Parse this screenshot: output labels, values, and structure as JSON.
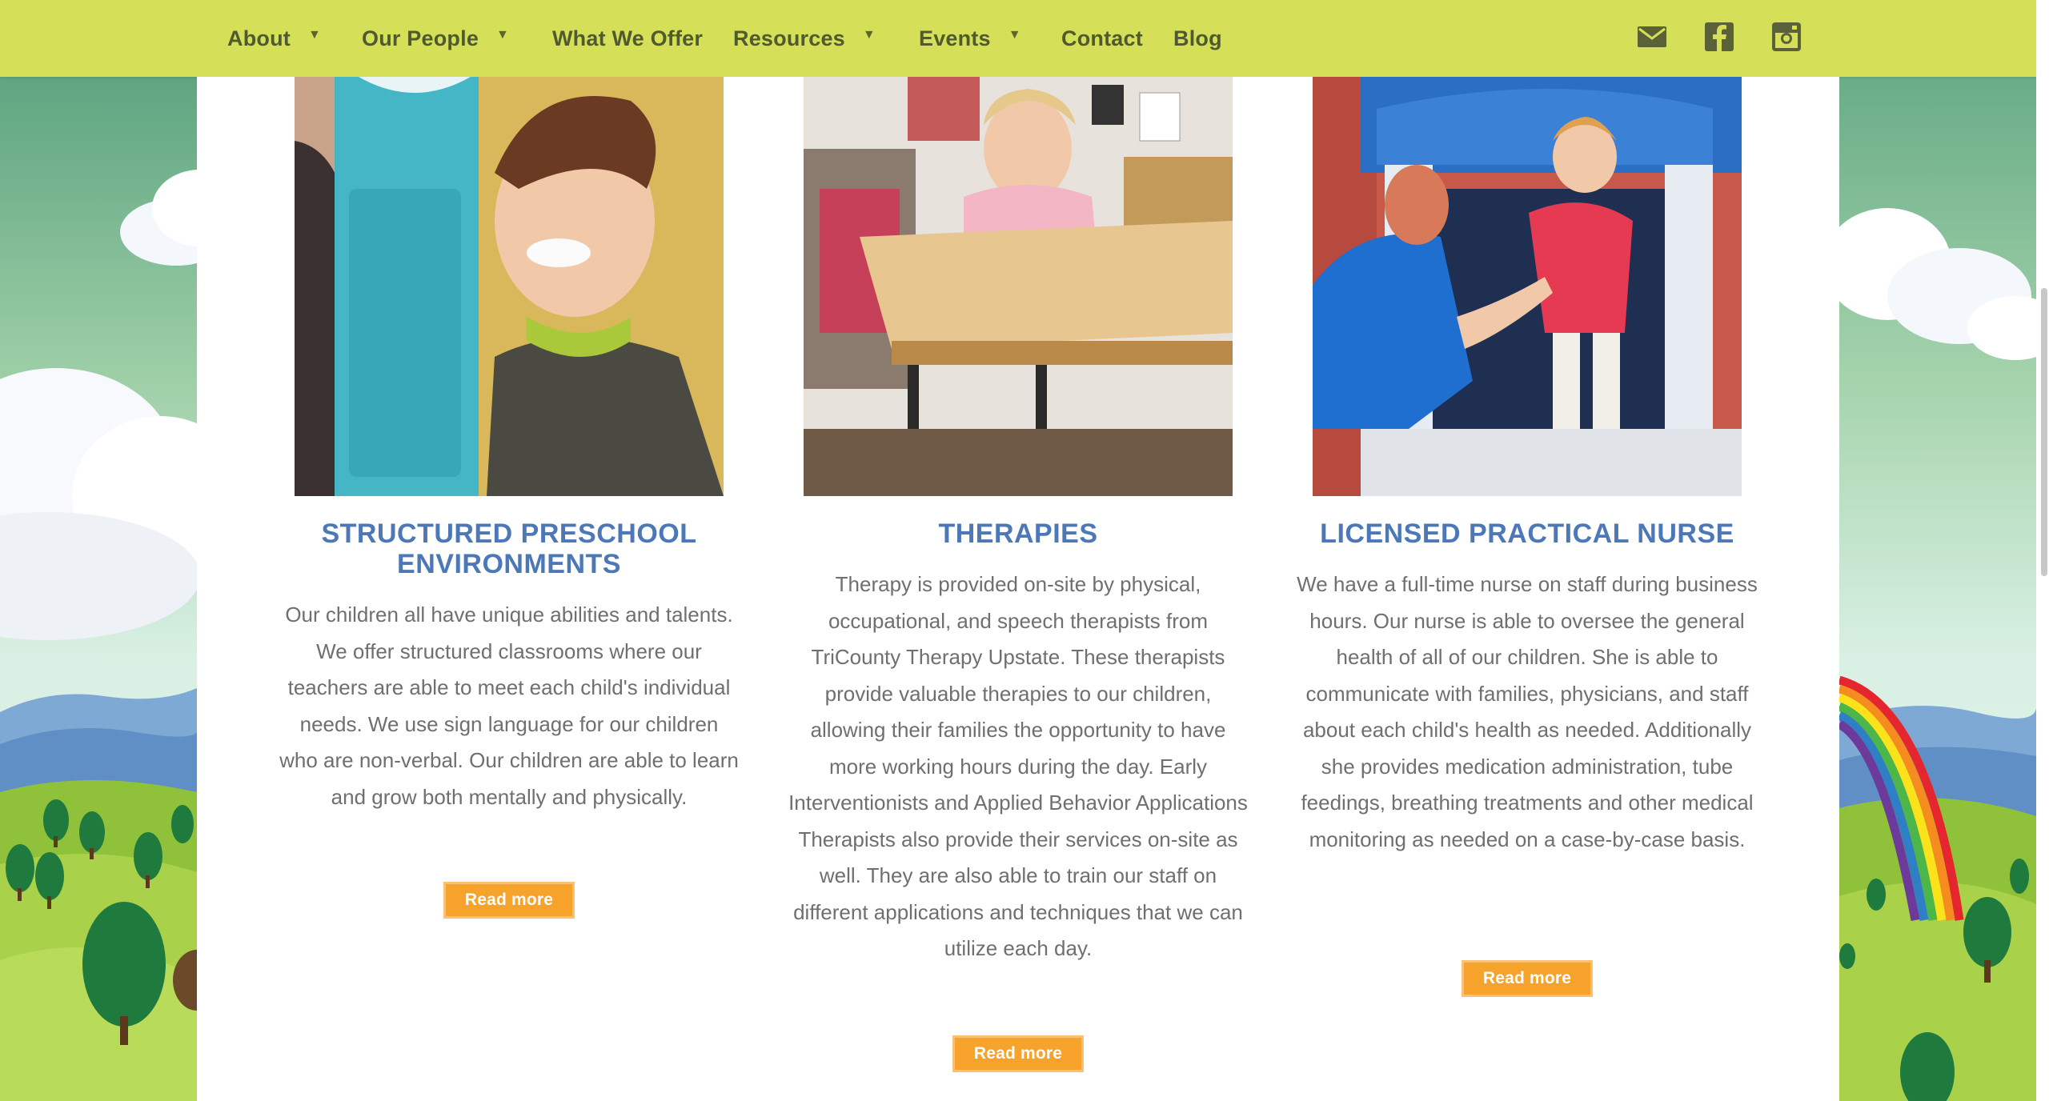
{
  "nav": {
    "items": [
      {
        "label": "About",
        "has_dropdown": true
      },
      {
        "label": "Our People",
        "has_dropdown": true
      },
      {
        "label": "What We Offer",
        "has_dropdown": false
      },
      {
        "label": "Resources",
        "has_dropdown": true
      },
      {
        "label": "Events",
        "has_dropdown": true
      },
      {
        "label": "Contact",
        "has_dropdown": false
      },
      {
        "label": "Blog",
        "has_dropdown": false
      }
    ],
    "caret_glyph": "▼",
    "social_icons": [
      "email-icon",
      "facebook-icon",
      "instagram-icon"
    ],
    "background_color": "#d5df57"
  },
  "cards": [
    {
      "title": "STRUCTURED PRESCHOOL ENVIRONMENTS",
      "body": "Our children all have unique abilities and talents. We offer structured classrooms where our teachers are able to meet each child's individual needs. We use sign language for our children who are non-verbal. Our children are able to learn and grow both mentally and physically.",
      "button": "Read more"
    },
    {
      "title": "THERAPIES",
      "body": "Therapy is provided on-site by physical, occupational, and speech therapists from TriCounty Therapy Upstate. These therapists provide valuable therapies to our children, allowing their families the opportunity to have more working hours during the day. Early Interventionists and Applied Behavior Applications Therapists also provide their services on-site as well. They are also able to train our staff on different applications and techniques that we can utilize each day.",
      "button": "Read more"
    },
    {
      "title": "LICENSED PRACTICAL NURSE",
      "body": "We have a full-time nurse on staff during business hours. Our nurse is able to oversee the general health of all of our children. She is able to communicate with families, physicians, and staff about each child's health as needed. Additionally she provides medication administration, tube feedings, breathing treatments and other medical monitoring as needed on a case-by-case basis.",
      "button": "Read more"
    }
  ],
  "colors": {
    "title": "#4d78b7",
    "body_text": "#6f6f6f",
    "button": "#f7a22a",
    "panel": "#ffffff"
  }
}
